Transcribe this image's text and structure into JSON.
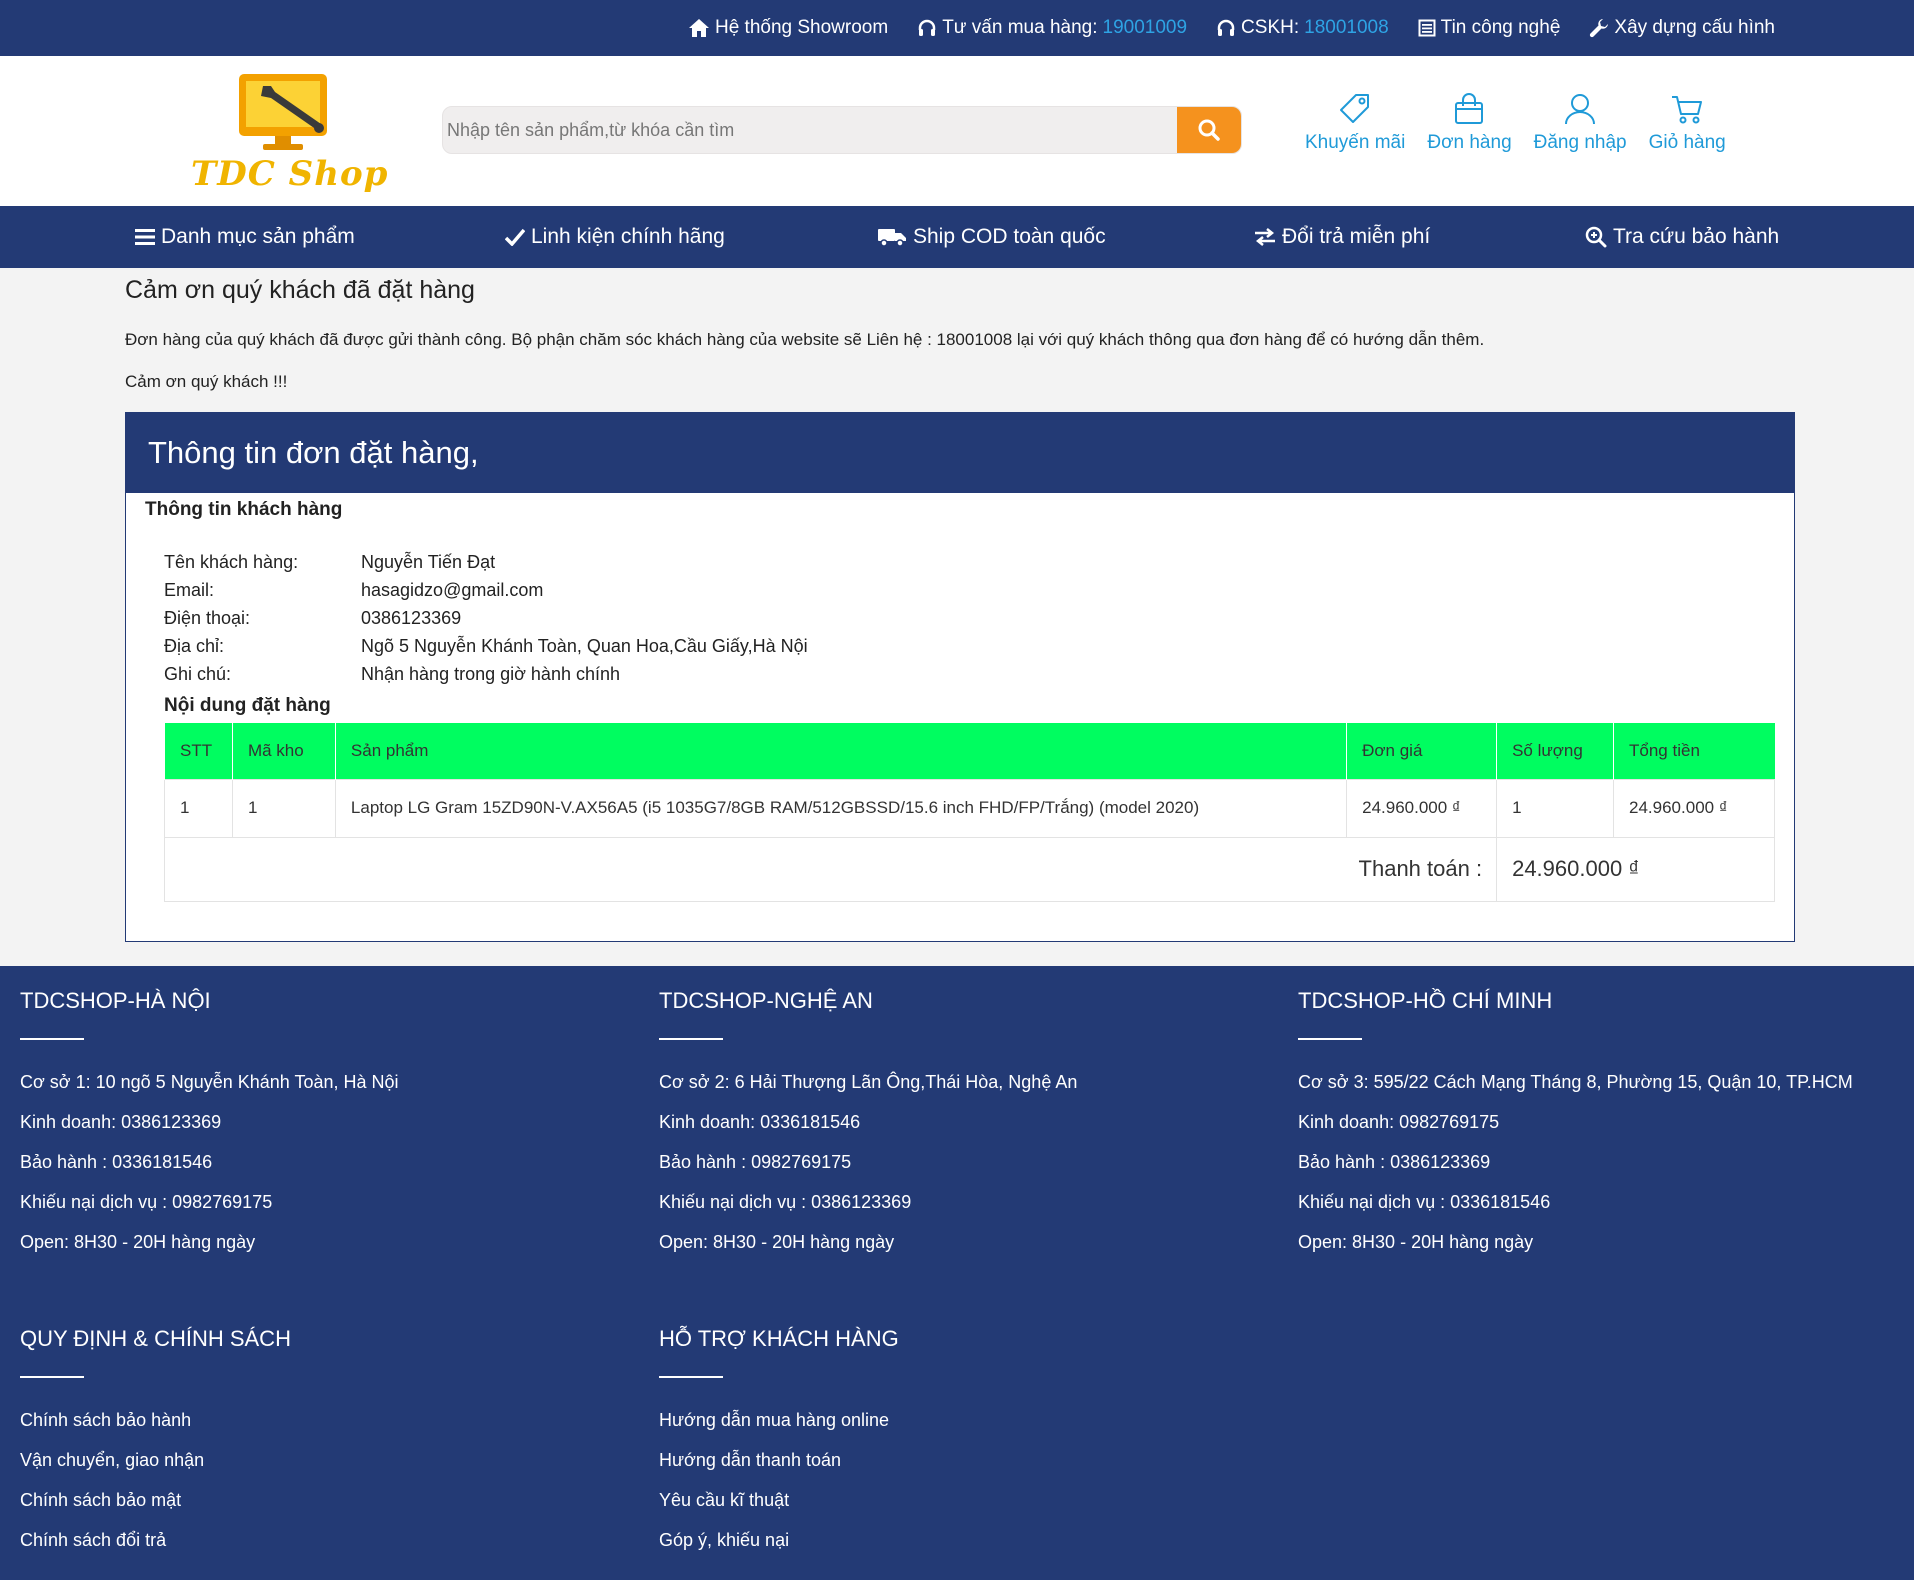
{
  "topbar": {
    "showroom": "Hệ thống Showroom",
    "consult_label": "Tư vấn mua hàng:",
    "consult_phone": "19001009",
    "cskh_label": "CSKH:",
    "cskh_phone": "18001008",
    "news": "Tin công nghệ",
    "build": "Xây dựng cấu hình"
  },
  "header": {
    "logo_text": "TDC Shop",
    "search_placeholder": "Nhập tên sản phẩm,từ khóa cần tìm",
    "icons": {
      "promo": "Khuyến mãi",
      "orders": "Đơn hàng",
      "login": "Đăng nhập",
      "cart": "Giỏ hàng"
    }
  },
  "nav": {
    "categories": "Danh mục sản phẩm",
    "genuine": "Linh kiện chính hãng",
    "ship": "Ship COD toàn quốc",
    "returns": "Đổi trả miễn phí",
    "warranty": "Tra cứu bảo hành"
  },
  "thanks": {
    "title": "Cảm ơn quý khách đã đặt hàng",
    "message": "Đơn hàng của quý khách đã được gửi thành công. Bộ phận chăm sóc khách hàng của website sẽ Liên hệ : 18001008 lại với quý khách thông qua đơn hàng để có hướng dẫn thêm.",
    "short": "Cảm ơn quý khách !!!"
  },
  "order": {
    "panel_title": "Thông tin đơn đặt hàng,",
    "customer_title": "Thông tin khách hàng",
    "customer": {
      "name_label": "Tên khách hàng:",
      "name": "Nguyễn Tiến Đạt",
      "email_label": "Email:",
      "email": "hasagidzo@gmail.com",
      "phone_label": "Điện thoại:",
      "phone": "0386123369",
      "address_label": "Địa chỉ:",
      "address": "Ngõ 5 Nguyễn Khánh Toàn, Quan Hoa,Cầu Giấy,Hà Nội",
      "note_label": "Ghi chú:",
      "note": "Nhận hàng trong giờ hành chính"
    },
    "content_title": "Nội dung đặt hàng",
    "columns": {
      "stt": "STT",
      "sku": "Mã kho",
      "product": "Sản phẩm",
      "price": "Đơn giá",
      "qty": "Số lượng",
      "total": "Tổng tiền"
    },
    "items": [
      {
        "stt": "1",
        "sku": "1",
        "product": "Laptop LG Gram 15ZD90N-V.AX56A5 (i5 1035G7/8GB RAM/512GBSSD/15.6 inch FHD/FP/Trắng) (model 2020)",
        "price": "24.960.000 ₫",
        "qty": "1",
        "total": "24.960.000 ₫"
      }
    ],
    "pay_label": "Thanh toán :",
    "pay_value": "24.960.000 ₫"
  },
  "footer": {
    "hanoi": {
      "title": "TDCSHOP-HÀ NỘI",
      "lines": [
        "Cơ sở 1: 10 ngõ 5 Nguyễn Khánh Toàn, Hà Nội",
        "Kinh doanh: 0386123369",
        "Bảo hành : 0336181546",
        "Khiếu nại dịch vụ : 0982769175",
        "Open: 8H30 - 20H hàng ngày"
      ]
    },
    "nghean": {
      "title": "TDCSHOP-NGHỆ AN",
      "lines": [
        "Cơ sở 2: 6 Hải Thượng Lãn Ông,Thái Hòa, Nghệ An",
        "Kinh doanh: 0336181546",
        "Bảo hành : 0982769175",
        "Khiếu nại dịch vụ : 0386123369",
        "Open: 8H30 - 20H hàng ngày"
      ]
    },
    "hcm": {
      "title": "TDCSHOP-HỒ CHÍ MINH",
      "lines": [
        "Cơ sở 3: 595/22 Cách Mạng Tháng 8, Phường 15, Quận 10, TP.HCM",
        "Kinh doanh: 0982769175",
        "Bảo hành : 0386123369",
        "Khiếu nại dịch vụ : 0336181546",
        "Open: 8H30 - 20H hàng ngày"
      ]
    },
    "policy": {
      "title": "QUY ĐỊNH & CHÍNH SÁCH",
      "links": [
        "Chính sách bảo hành",
        "Vận chuyển, giao nhận",
        "Chính sách bảo mật",
        "Chính sách đổi trả"
      ]
    },
    "support": {
      "title": "HỖ TRỢ KHÁCH HÀNG",
      "links": [
        "Hướng dẫn mua hàng online",
        "Hướng dẫn thanh toán",
        "Yêu cầu kĩ thuật",
        "Góp ý, khiếu nại"
      ]
    }
  },
  "colors": {
    "primary": "#233a75",
    "accent": "#f5921e",
    "link": "#1f9ad8",
    "table_head": "#00fd60",
    "price": "#f01e1e"
  }
}
